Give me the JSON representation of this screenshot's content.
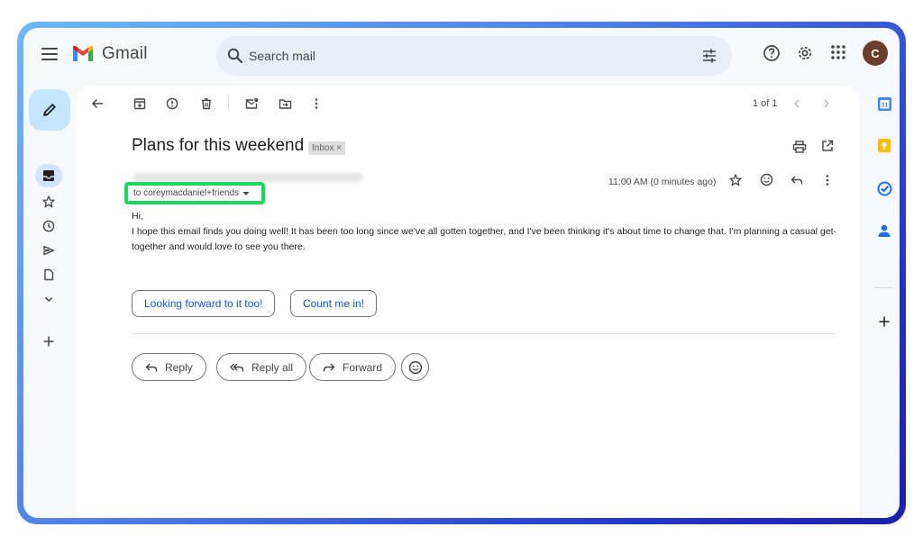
{
  "app": {
    "name": "Gmail",
    "avatar_initial": "C"
  },
  "search": {
    "placeholder": "Search mail"
  },
  "pagination": {
    "text": "1 of 1"
  },
  "email": {
    "subject": "Plans for this weekend",
    "label": "Inbox ×",
    "recipient": "to coreymacdaniel+friends",
    "timestamp": "11:00 AM (0 minutes ago)",
    "greeting": "Hi,",
    "body": "I hope this email finds you doing well! It has been too long since we've all gotten together, and I've been thinking it's about time to change that. I'm planning a casual get-together and would love to see you there."
  },
  "smart_replies": [
    "Looking forward to it too!",
    "Count me in!"
  ],
  "actions": {
    "reply": "Reply",
    "reply_all": "Reply all",
    "forward": "Forward"
  },
  "colors": {
    "highlight": "#1ed760",
    "compose_bg": "#c2e7ff",
    "link": "#0b57d0",
    "avatar": "#6b3d2a"
  }
}
